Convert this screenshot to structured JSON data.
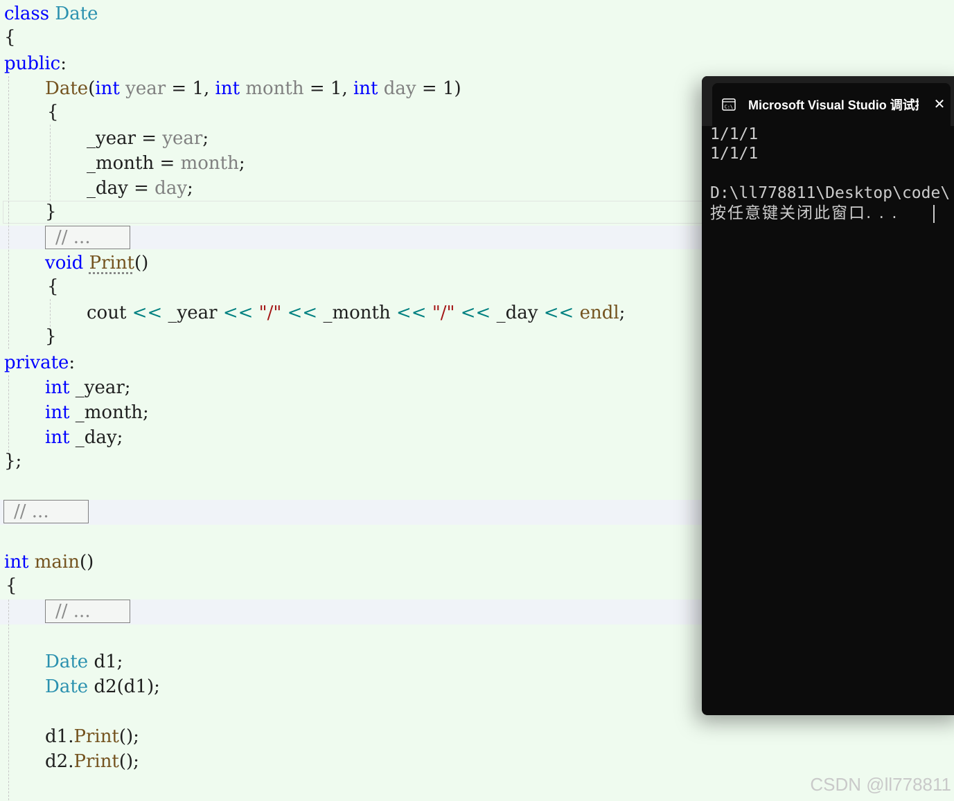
{
  "code": {
    "class_kw": "class",
    "class_name": "Date",
    "open_brace": "{",
    "public_kw": "public",
    "colon": ":",
    "ctor_name": "Date",
    "int_kw": "int",
    "param_year": "year",
    "param_month": "month",
    "param_day": "day",
    "default_val": "1",
    "member_year": "_year",
    "member_month": "_month",
    "member_day": "_day",
    "close_brace": "}",
    "folded_comment": "// ...",
    "void_kw": "void",
    "print_name": "Print",
    "cout": "cout",
    "shift_op": "<<",
    "slash_str": "\"/\"",
    "endl": "endl",
    "private_kw": "private",
    "class_end": "};",
    "main_name": "main",
    "var_d1": "d1",
    "var_d2": "d2"
  },
  "console": {
    "title": "Microsoft Visual Studio 调试控制台",
    "close_glyph": "✕",
    "output_line1": "1/1/1",
    "output_line2": "1/1/1",
    "path_line": "D:\\ll778811\\Desktop\\code\\",
    "prompt_line": "按任意键关闭此窗口. . ."
  },
  "watermark": "CSDN @ll778811"
}
